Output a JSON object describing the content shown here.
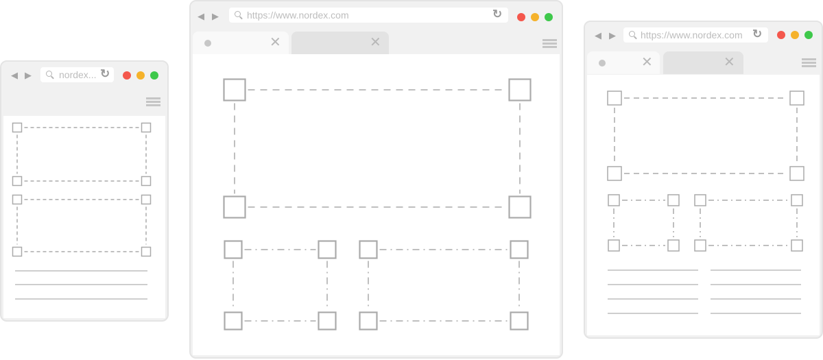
{
  "windows": {
    "small": {
      "url_text": "nordex..."
    },
    "large": {
      "url_text": "https://www.nordex.com"
    },
    "medium": {
      "url_text": "https://www.nordex.com"
    }
  },
  "colors": {
    "close": "#f4574c",
    "minimize": "#f5b22b",
    "maximize": "#3ec84b",
    "wireframe": "#aaaaaa"
  },
  "icons": [
    "back-arrow-icon",
    "forward-arrow-icon",
    "search-icon",
    "reload-icon",
    "close-tab-icon",
    "hamburger-menu-icon"
  ]
}
